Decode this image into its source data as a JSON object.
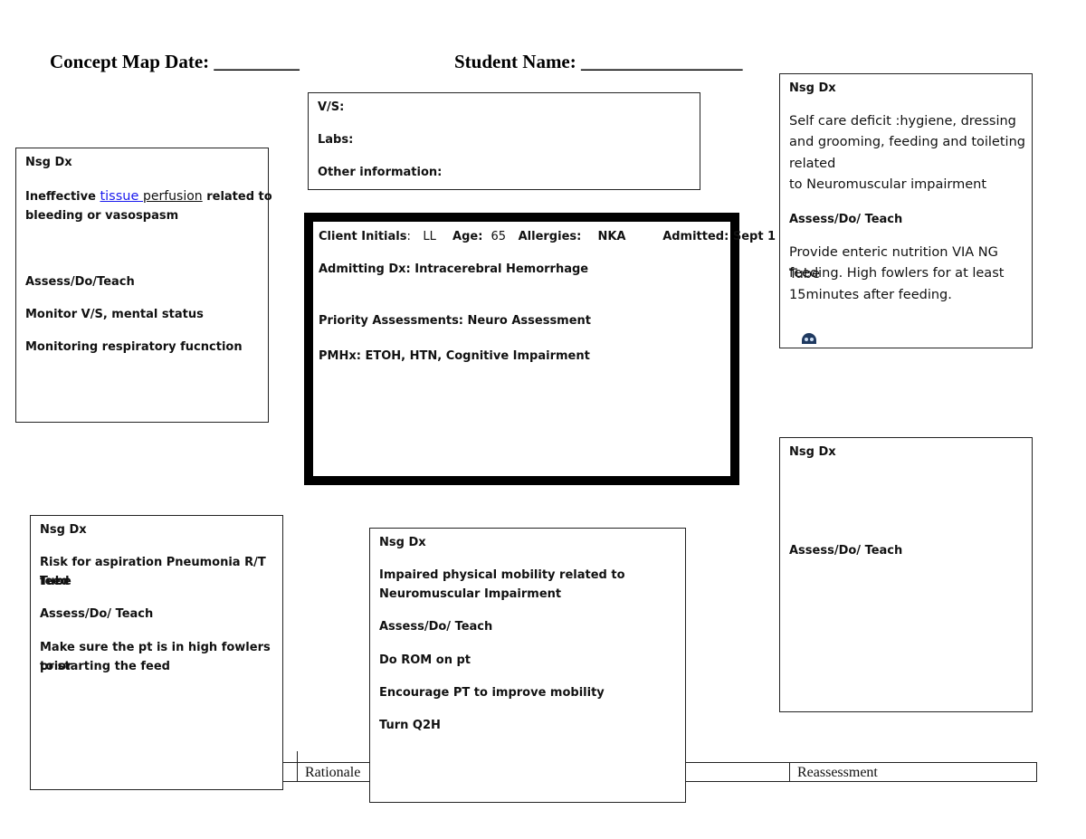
{
  "header": {
    "date_label": "Concept Map Date: _________",
    "student_label": "Student Name: _________________"
  },
  "vitals_box": {
    "vs_label": "V/S:",
    "labs_label": "Labs:",
    "other_label": "Other information:"
  },
  "client_box": {
    "initials_label": "Client Initials",
    "initials_colon": ":",
    "initials_value": "LL",
    "age_label": "Age:",
    "age_value": "65",
    "allergies_label": "Allergies:",
    "allergies_value": "NKA",
    "admitted": "Admitted: Sept 1",
    "admitting_dx": "Admitting Dx: Intracerebral Hemorrhage",
    "priority_assessments": "Priority Assessments: Neuro Assessment",
    "pmhx": "PMHx: ETOH, HTN, Cognitive Impairment"
  },
  "nsg_dx_1": {
    "heading": "Nsg Dx",
    "dx_prefix": "Ineffective ",
    "dx_link": "tissue ",
    "dx_underlined": "perfusion",
    "dx_suffix": " related to",
    "dx_line2": "bleeding or vasospasm",
    "assess_heading": "Assess/Do/Teach",
    "items": [
      "Monitor V/S, mental status",
      "Monitoring respiratory fucnction"
    ]
  },
  "nsg_dx_2": {
    "heading": "Nsg Dx",
    "dx_lines": [
      "Self care deficit :hygiene, dressing",
      "and grooming, feeding and toileting",
      "related",
      "to Neuromuscular impairment"
    ],
    "assess_heading": "Assess/Do/ Teach",
    "items": [
      "Provide enteric nutrition VIA NG Tube",
      "feeding. High fowlers for at least",
      "15minutes after feeding."
    ]
  },
  "nsg_dx_3": {
    "heading": "Nsg Dx",
    "assess_heading": "Assess/Do/ Teach"
  },
  "nsg_dx_4": {
    "heading": "Nsg Dx",
    "dx_lines": [
      "Risk for aspiration Pneumonia R/T Tube",
      "feed"
    ],
    "assess_heading": "Assess/Do/ Teach",
    "items": [
      "Make sure the pt is in high fowlers prior",
      "to starting the feed"
    ]
  },
  "nsg_dx_5": {
    "heading": "Nsg Dx",
    "dx_lines": [
      "Impaired physical mobility related to",
      "Neuromuscular Impairment"
    ],
    "assess_heading": "Assess/Do/ Teach",
    "items": [
      "Do ROM on pt",
      "Encourage PT to improve mobility",
      "Turn Q2H"
    ]
  },
  "table": {
    "rationale_label": "Rationale",
    "reassessment_label": "Reassessment"
  },
  "icons": {
    "avatar": "avatar-icon"
  }
}
